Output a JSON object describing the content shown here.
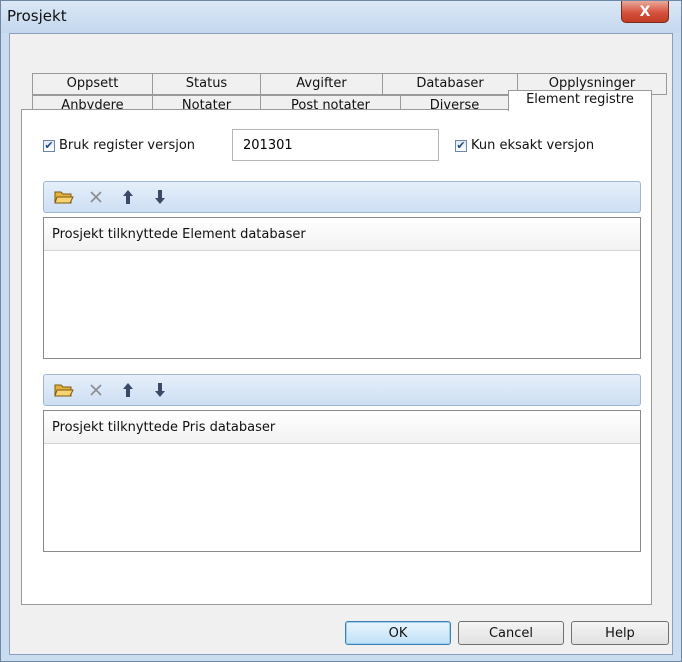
{
  "window": {
    "title": "Prosjekt",
    "close_label": "X"
  },
  "tabs_row1": [
    "Oppsett",
    "Status",
    "Avgifter",
    "Databaser",
    "Opplysninger"
  ],
  "tabs_row2": [
    "Anbydere",
    "Notater",
    "Post notater",
    "Diverse",
    "Element registre"
  ],
  "active_tab": "Element registre",
  "register": {
    "use_version_label": "Bruk register versjon",
    "use_version_checked": true,
    "version_value": "201301",
    "exact_version_label": "Kun eksakt versjon",
    "exact_version_checked": true
  },
  "element_section": {
    "header": "Prosjekt tilknyttede Element databaser",
    "items": []
  },
  "price_section": {
    "header": "Prosjekt tilknyttede Pris databaser",
    "items": []
  },
  "toolbar_icons": [
    "open-folder-icon",
    "delete-x-icon",
    "move-up-icon",
    "move-down-icon"
  ],
  "buttons": {
    "ok": "OK",
    "cancel": "Cancel",
    "help": "Help"
  },
  "colors": {
    "accent": "#3c7fb1",
    "close": "#c13a24",
    "toolbar": "#cddff3"
  }
}
